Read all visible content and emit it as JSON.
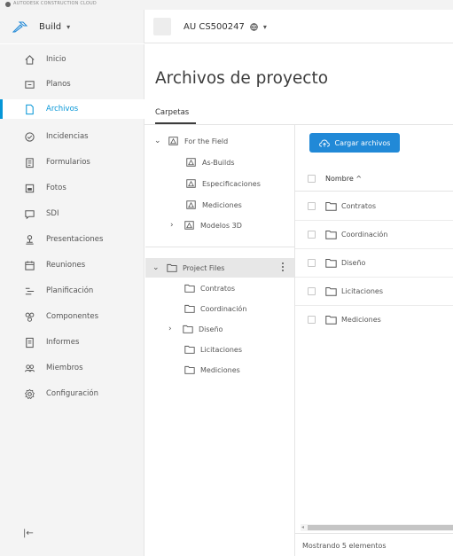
{
  "brand": {
    "name": "AUTODESK CONSTRUCTION CLOUD"
  },
  "module": {
    "label": "Build",
    "icon": "build-icon"
  },
  "project": {
    "name": "AU CS500247",
    "icon": "globe-icon"
  },
  "sidebar": {
    "items": [
      {
        "label": "Inicio",
        "icon": "home-icon"
      },
      {
        "label": "Planos",
        "icon": "sheets-icon"
      },
      {
        "label": "Archivos",
        "icon": "file-icon",
        "active": true
      },
      {
        "label": "Incidencias",
        "icon": "issues-icon"
      },
      {
        "label": "Formularios",
        "icon": "forms-icon"
      },
      {
        "label": "Fotos",
        "icon": "photos-icon"
      },
      {
        "label": "SDI",
        "icon": "rfi-icon"
      },
      {
        "label": "Presentaciones",
        "icon": "submittals-icon"
      },
      {
        "label": "Reuniones",
        "icon": "meetings-icon"
      },
      {
        "label": "Planificación",
        "icon": "schedule-icon"
      },
      {
        "label": "Componentes",
        "icon": "components-icon"
      },
      {
        "label": "Informes",
        "icon": "reports-icon"
      },
      {
        "label": "Miembros",
        "icon": "members-icon"
      },
      {
        "label": "Configuración",
        "icon": "settings-icon"
      }
    ],
    "collapse_label": "|←"
  },
  "header": {
    "title": "Archivos de proyecto",
    "tab": "Carpetas"
  },
  "tree": {
    "field": {
      "label": "For the Field",
      "children": [
        "As-Builds",
        "Especificaciones",
        "Mediciones",
        "Modelos 3D"
      ]
    },
    "project_files": {
      "label": "Project Files",
      "children": [
        "Contratos",
        "Coordinación",
        "Diseño",
        "Licitaciones",
        "Mediciones"
      ]
    }
  },
  "files": {
    "upload_label": "Cargar archivos",
    "column_name": "Nombre ^",
    "rows": [
      "Contratos",
      "Coordinación",
      "Diseño",
      "Licitaciones",
      "Mediciones"
    ],
    "footer": "Mostrando 5 elementos"
  },
  "colors": {
    "accent": "#0696d7",
    "upload": "#2189d7"
  }
}
